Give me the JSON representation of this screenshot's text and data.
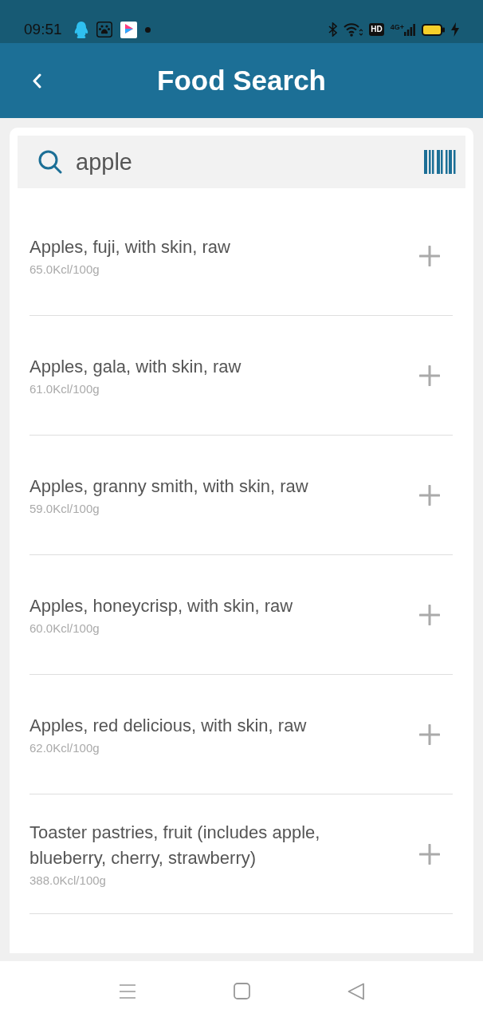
{
  "status_bar": {
    "time": "09:51",
    "hd_badge": "HD",
    "network_type": "4G+"
  },
  "header": {
    "title": "Food Search"
  },
  "search": {
    "value": "apple"
  },
  "results": [
    {
      "name": "Apples, fuji, with skin, raw",
      "calories": "65.0Kcl/100g"
    },
    {
      "name": "Apples, gala, with skin, raw",
      "calories": "61.0Kcl/100g"
    },
    {
      "name": "Apples, granny smith, with skin, raw",
      "calories": "59.0Kcl/100g"
    },
    {
      "name": "Apples, honeycrisp, with skin, raw",
      "calories": "60.0Kcl/100g"
    },
    {
      "name": "Apples, red delicious, with skin, raw",
      "calories": "62.0Kcl/100g"
    },
    {
      "name": "Toaster pastries, fruit (includes apple, blueberry, cherry, strawberry)",
      "calories": "388.0Kcl/100g"
    }
  ]
}
